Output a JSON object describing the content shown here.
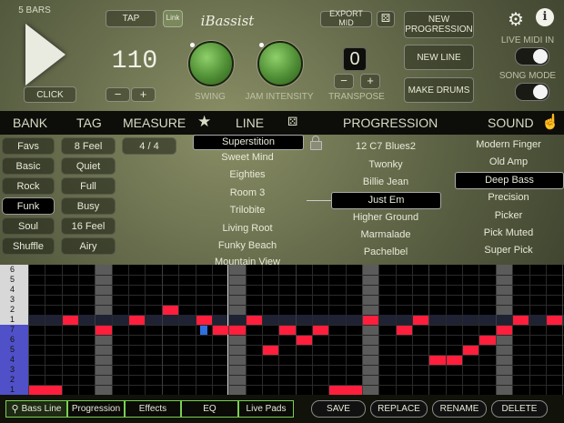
{
  "transport": {
    "bars_label": "5 BARS",
    "click_label": "CLICK",
    "tempo": "110",
    "minus": "−",
    "plus": "+"
  },
  "top": {
    "tap_label": "TAP",
    "link_label": "Link",
    "logo_text": "iBassist",
    "export_midi_label": "EXPORT MID",
    "new_progression_label": "NEW\nPROGRESSION",
    "new_line_label": "NEW LINE",
    "make_drums_label": "MAKE DRUMS",
    "swing_label": "SWING",
    "jam_intensity_label": "JAM INTENSITY",
    "transpose_label": "TRANSPOSE",
    "transpose_value": "0",
    "live_midi_label": "LIVE MIDI IN",
    "song_mode_label": "SONG MODE"
  },
  "header": {
    "bank": "BANK",
    "tag": "TAG",
    "measure": "MEASURE",
    "line": "LINE",
    "progression": "PROGRESSION",
    "sound": "SOUND"
  },
  "banks": [
    "Favs",
    "Basic",
    "Rock",
    "Funk",
    "Soul",
    "Shuffle"
  ],
  "bank_selected": 3,
  "tags": [
    "8 Feel",
    "Quiet",
    "Full",
    "Busy",
    "16 Feel",
    "Airy"
  ],
  "measure": "4 / 4",
  "lines": [
    "Superstition",
    "Sweet Mind",
    "Eighties",
    "Room 3",
    "Trilobite",
    "Living Root",
    "Funky Beach",
    "Mountain View"
  ],
  "line_selected": 0,
  "progressions": [
    "12 C7 Blues2",
    "Twonky",
    "Billie Jean",
    "Just Em",
    "Higher Ground",
    "Marmalade",
    "Pachelbel"
  ],
  "progression_selected": 3,
  "sounds": [
    "Modern Finger",
    "Old Amp",
    "Deep Bass",
    "Precision",
    "Picker",
    "Pick Muted",
    "Super Pick"
  ],
  "sound_selected": 2,
  "grid_rows": [
    "6",
    "5",
    "4",
    "3",
    "2",
    "1",
    "7",
    "6",
    "5",
    "4",
    "3",
    "2",
    "1"
  ],
  "tabs": [
    "Bass Line",
    "Progression",
    "Effects",
    "EQ",
    "Live Pads"
  ],
  "actions": [
    "SAVE",
    "REPLACE",
    "RENAME",
    "DELETE"
  ],
  "colors": {
    "note": "#ff1f3d",
    "selected_note": "#2f6fe0",
    "accent_green": "#7ad050"
  }
}
